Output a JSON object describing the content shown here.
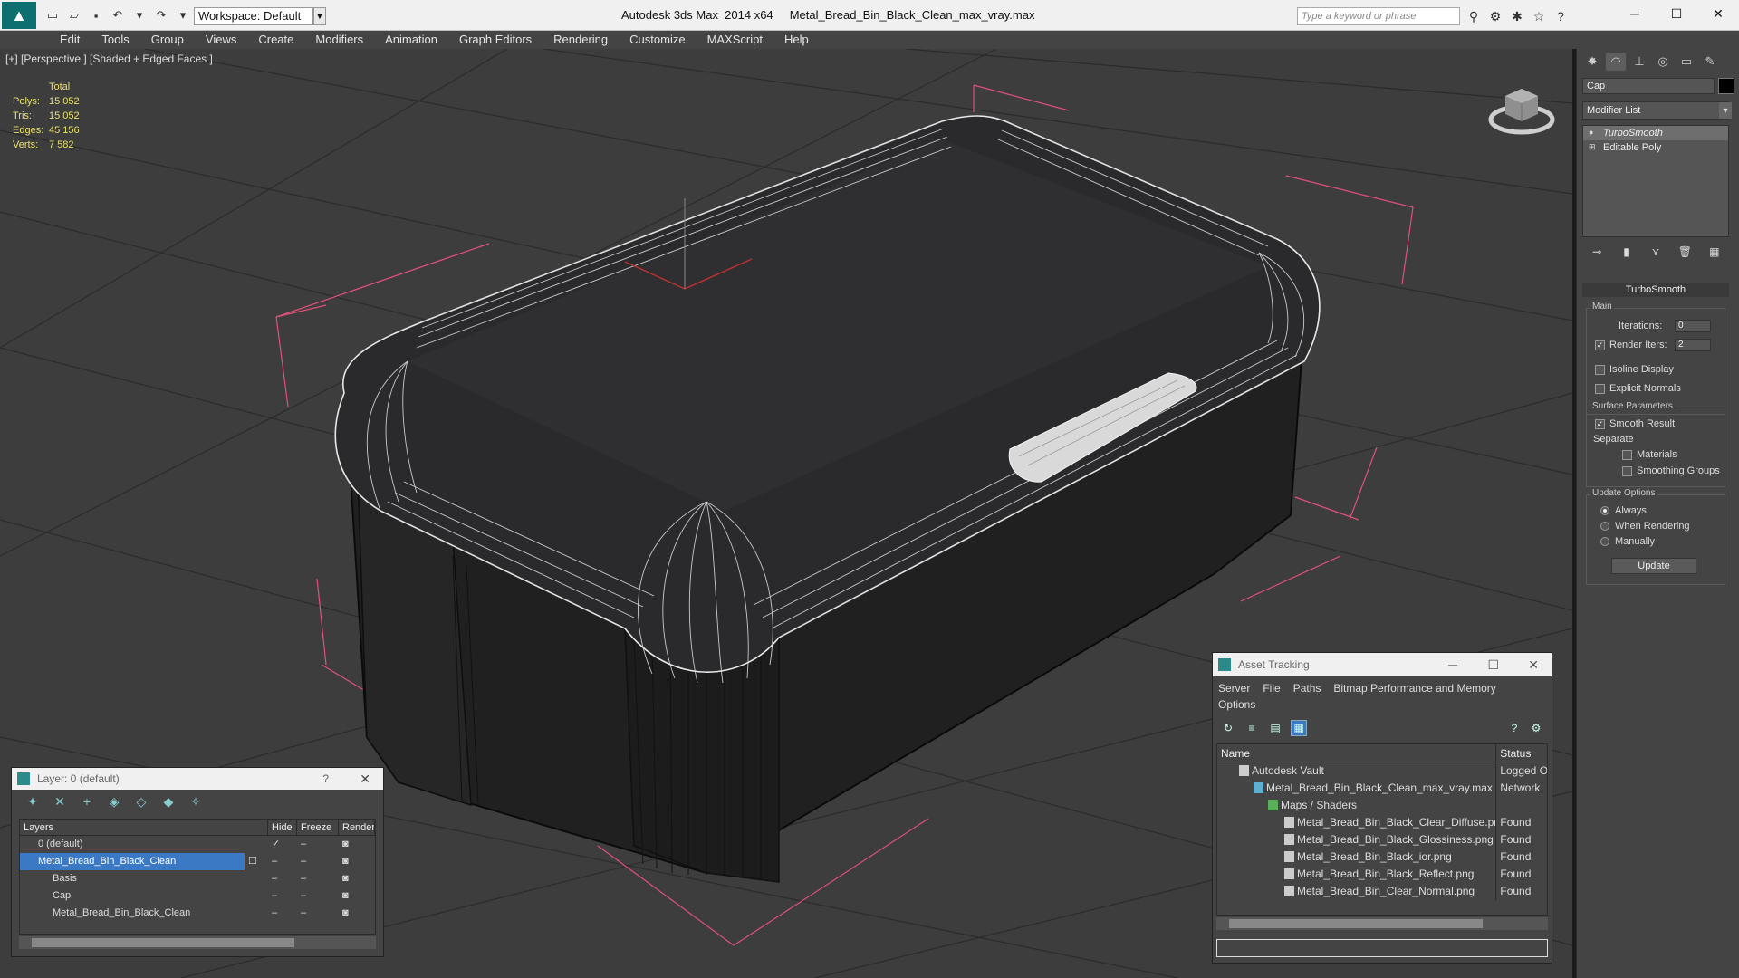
{
  "app": {
    "title": "Autodesk 3ds Max  2014 x64     Metal_Bread_Bin_Black_Clean_max_vray.max",
    "workspace": "Workspace: Default",
    "search_placeholder": "Type a keyword or phrase"
  },
  "menu": [
    "Edit",
    "Tools",
    "Group",
    "Views",
    "Create",
    "Modifiers",
    "Animation",
    "Graph Editors",
    "Rendering",
    "Customize",
    "MAXScript",
    "Help"
  ],
  "viewport": {
    "label": "[+] [Perspective ] [Shaded + Edged Faces ]",
    "stats": {
      "header": "Total",
      "rows": [
        {
          "k": "Polys:",
          "v": "15 052"
        },
        {
          "k": "Tris:",
          "v": "15 052"
        },
        {
          "k": "Edges:",
          "v": "45 156"
        },
        {
          "k": "Verts:",
          "v": "7 582"
        }
      ]
    }
  },
  "command_panel": {
    "object_name": "Cap",
    "modifier_list": "Modifier List",
    "stack": [
      "TurboSmooth",
      "Editable Poly"
    ],
    "rollout": "TurboSmooth",
    "main_group": "Main",
    "iterations_label": "Iterations:",
    "iterations": "0",
    "render_iters_label": "Render Iters:",
    "render_iters": "2",
    "isoline": "Isoline Display",
    "explicit_normals": "Explicit Normals",
    "surface_group": "Surface Parameters",
    "smooth_result": "Smooth Result",
    "separate": "Separate",
    "materials": "Materials",
    "smoothing_groups": "Smoothing Groups",
    "update_group": "Update Options",
    "always": "Always",
    "when_rendering": "When Rendering",
    "manually": "Manually",
    "update_button": "Update"
  },
  "layer_window": {
    "title": "Layer: 0 (default)",
    "help": "?",
    "columns": [
      "Layers",
      "Hide",
      "Freeze",
      "Render"
    ],
    "rows": [
      {
        "name": "0 (default)",
        "indent": 1,
        "selected": false
      },
      {
        "name": "Metal_Bread_Bin_Black_Clean",
        "indent": 1,
        "selected": true
      },
      {
        "name": "Basis",
        "indent": 2,
        "selected": false
      },
      {
        "name": "Cap",
        "indent": 2,
        "selected": false
      },
      {
        "name": "Metal_Bread_Bin_Black_Clean",
        "indent": 2,
        "selected": false
      }
    ]
  },
  "asset_window": {
    "title": "Asset Tracking",
    "menu": [
      "Server",
      "File",
      "Paths",
      "Bitmap Performance and Memory",
      "Options"
    ],
    "columns": [
      "Name",
      "Status"
    ],
    "rows": [
      {
        "name": "Autodesk Vault",
        "status": "Logged O",
        "indent": 1
      },
      {
        "name": "Metal_Bread_Bin_Black_Clean_max_vray.max",
        "status": "Network",
        "indent": 2
      },
      {
        "name": "Maps / Shaders",
        "status": "",
        "indent": 3
      },
      {
        "name": "Metal_Bread_Bin_Black_Clear_Diffuse.png",
        "status": "Found",
        "indent": 4
      },
      {
        "name": "Metal_Bread_Bin_Black_Glossiness.png",
        "status": "Found",
        "indent": 4
      },
      {
        "name": "Metal_Bread_Bin_Black_ior.png",
        "status": "Found",
        "indent": 4
      },
      {
        "name": "Metal_Bread_Bin_Black_Reflect.png",
        "status": "Found",
        "indent": 4
      },
      {
        "name": "Metal_Bread_Bin_Clear_Normal.png",
        "status": "Found",
        "indent": 4
      }
    ]
  },
  "colors": {
    "selection": "#3b79c4",
    "stats": "#e8e070",
    "bbox": "#e0507a",
    "viewport_bg": "#3d3d3d"
  }
}
